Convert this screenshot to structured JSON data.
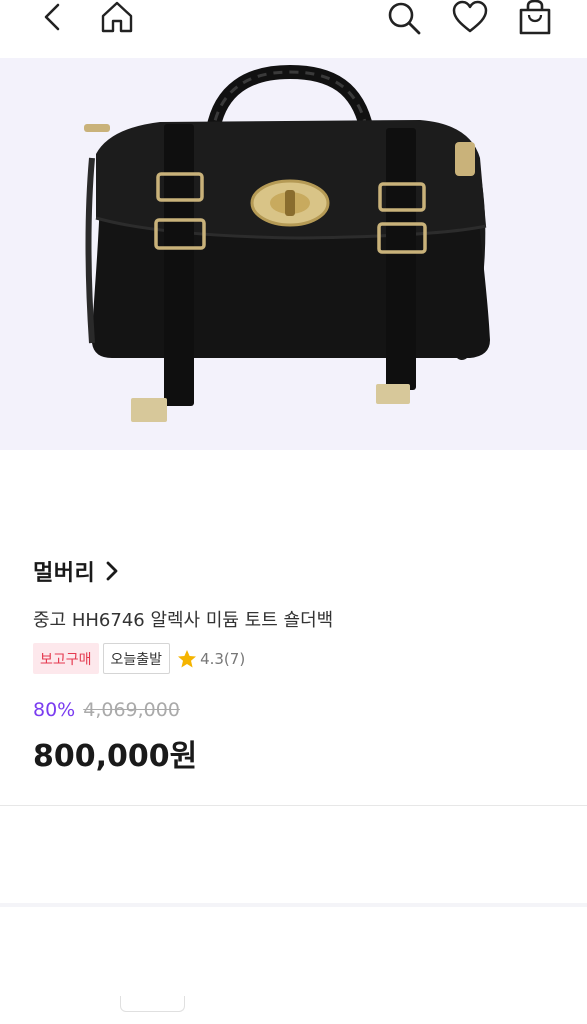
{
  "header": {
    "icons": [
      "back-arrow-icon",
      "home-icon",
      "search-icon",
      "heart-icon",
      "shopping-bag-icon"
    ]
  },
  "product": {
    "image_alt": "Black leather top-handle shoulder bag with braided handle and gold turn-lock",
    "brand": "멀버리",
    "title": "중고 HH6746 알렉사 미듐 토트 숄더백",
    "badges": [
      "보고구매",
      "오늘출발"
    ],
    "rating": "4.3",
    "review_count": "(7)",
    "discount": "80%",
    "original_price": "4,069,000",
    "final_price": "800,000원"
  },
  "colors": {
    "discount": "#7a3cf0",
    "badge_pink_text": "#e5394f",
    "badge_pink_bg": "#fde8ec",
    "star": "#f5b400"
  }
}
